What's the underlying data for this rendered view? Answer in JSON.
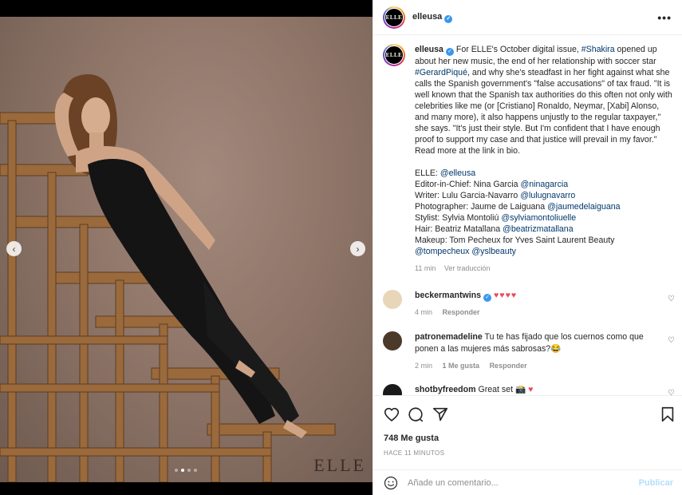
{
  "post": {
    "username": "elleusa",
    "avatar_text": "ELLE",
    "more_icon": "more-horizontal-icon",
    "photo": {
      "watermark": "ELLE",
      "slide_count": 4,
      "active_slide": 2
    }
  },
  "caption": {
    "username": "elleusa",
    "text_1": "For ELLE's October digital issue, ",
    "tag_shakira": "#Shakira",
    "text_2": " opened up about her new music, the end of her relationship with soccer star ",
    "tag_pique": "#GerardPiqué",
    "text_3": ", and why she's steadfast in her fight against what she calls the Spanish government's \"false accusations\" of tax fraud. \"It is well known that the Spanish tax authorities do this often not only with celebrities like me (or [Cristiano] Ronaldo, Neymar, [Xabi] Alonso, and many more), it also happens unjustly to the regular taxpayer,\" she says. \"It's just their style. But I'm confident that I have enough proof to support my case and that justice will prevail in my favor.\" Read more at the link in bio.",
    "credits": [
      {
        "label": "ELLE: ",
        "handle": "@elleusa"
      },
      {
        "label": "Editor-in-Chief: Nina Garcia ",
        "handle": "@ninagarcia"
      },
      {
        "label": "Writer: Lulu Garcia-Navarro ",
        "handle": "@lulugnavarro"
      },
      {
        "label": "Photographer: Jaume de Laiguana ",
        "handle": "@jaumedelaiguana"
      },
      {
        "label": "Stylist: Sylvia Montoliú ",
        "handle": "@sylviamontoliuelle"
      },
      {
        "label": "Hair: Beatriz Matallana ",
        "handle": "@beatrizmatallana"
      }
    ],
    "makeup_text": "Makeup: Tom Pecheux for Yves Saint Laurent Beauty",
    "makeup_handle_1": "@tompecheux",
    "makeup_handle_2": "@yslbeauty",
    "time": "11 min",
    "translate": "Ver traducción"
  },
  "comments": [
    {
      "user": "beckermantwins",
      "text": "",
      "hearts": "♥♥♥♥",
      "time": "4 min",
      "likes": "",
      "reply": "Responder",
      "avatar_color": "#e8d6b8"
    },
    {
      "user": "patronemadeline",
      "text": "Tu te has fijado que los cuernos como que ponen a las mujeres más sabrosas?😂",
      "hearts": "",
      "time": "2 min",
      "likes": "1 Me gusta",
      "reply": "Responder",
      "avatar_color": "#4b3a2a"
    },
    {
      "user": "shotbyfreedom",
      "text": "Great set 📸",
      "hearts": "♥",
      "time": "",
      "likes": "",
      "reply": "",
      "avatar_color": "#1a1a1a"
    }
  ],
  "actions": {
    "likes": "748 Me gusta",
    "posted": "HACE 11 MINUTOS"
  },
  "add_comment": {
    "placeholder": "Añade un comentario...",
    "publish": "Publicar"
  }
}
